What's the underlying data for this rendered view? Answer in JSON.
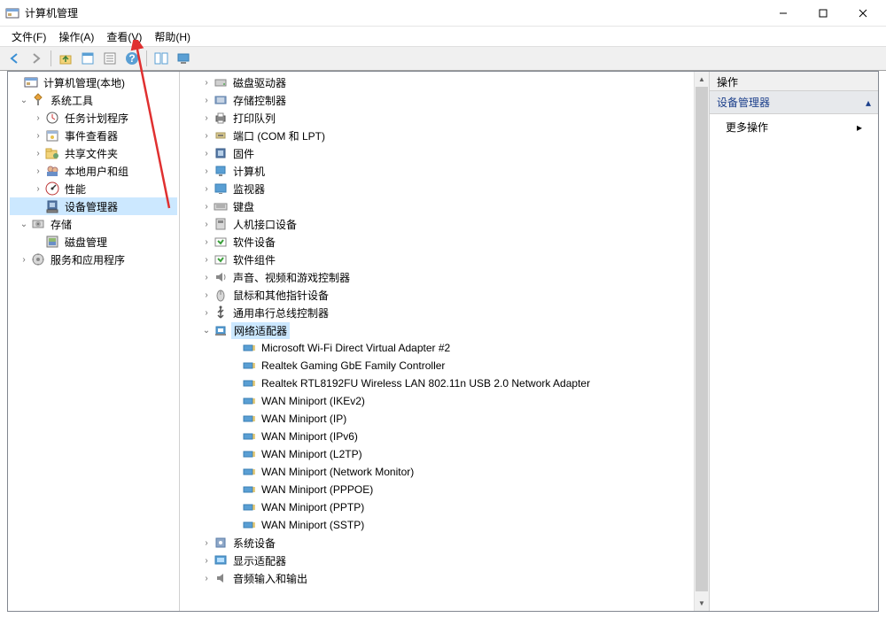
{
  "window": {
    "title": "计算机管理"
  },
  "menu": {
    "file": "文件(F)",
    "action": "操作(A)",
    "view": "查看(V)",
    "help": "帮助(H)"
  },
  "left_tree": {
    "root": "计算机管理(本地)",
    "system_tools": "系统工具",
    "task_scheduler": "任务计划程序",
    "event_viewer": "事件查看器",
    "shared_folders": "共享文件夹",
    "local_users": "本地用户和组",
    "performance": "性能",
    "device_manager": "设备管理器",
    "storage": "存储",
    "disk_management": "磁盘管理",
    "services_apps": "服务和应用程序"
  },
  "center_tree": {
    "disk_drives": "磁盘驱动器",
    "storage_controllers": "存储控制器",
    "print_queues": "打印队列",
    "ports": "端口 (COM 和 LPT)",
    "firmware": "固件",
    "computer": "计算机",
    "monitors": "监视器",
    "keyboards": "键盘",
    "hid": "人机接口设备",
    "software_devices": "软件设备",
    "software_components": "软件组件",
    "sound": "声音、视频和游戏控制器",
    "mice": "鼠标和其他指针设备",
    "usb_controllers": "通用串行总线控制器",
    "network_adapters": "网络适配器",
    "net_items": [
      "Microsoft Wi-Fi Direct Virtual Adapter #2",
      "Realtek Gaming GbE Family Controller",
      "Realtek RTL8192FU Wireless LAN 802.11n USB 2.0 Network Adapter",
      "WAN Miniport (IKEv2)",
      "WAN Miniport (IP)",
      "WAN Miniport (IPv6)",
      "WAN Miniport (L2TP)",
      "WAN Miniport (Network Monitor)",
      "WAN Miniport (PPPOE)",
      "WAN Miniport (PPTP)",
      "WAN Miniport (SSTP)"
    ],
    "system_devices": "系统设备",
    "display_adapters": "显示适配器",
    "audio_io": "音频输入和输出"
  },
  "right_panel": {
    "header": "操作",
    "section": "设备管理器",
    "more_actions": "更多操作"
  }
}
